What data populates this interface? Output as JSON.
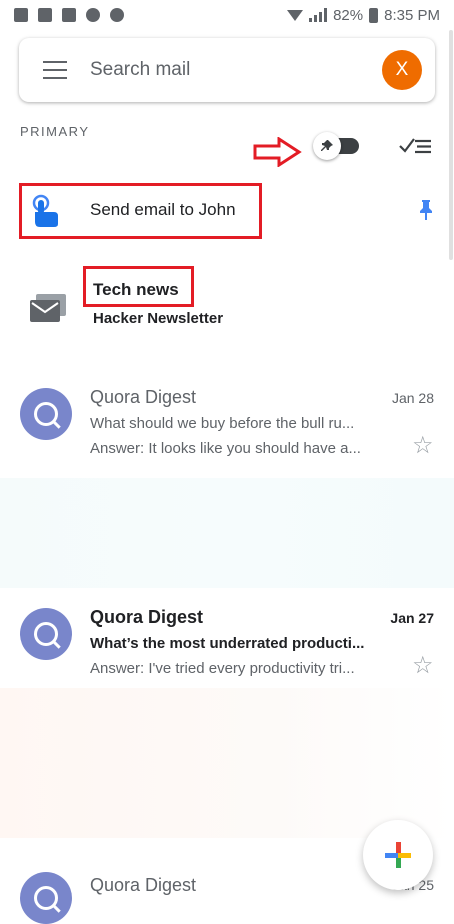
{
  "status_bar": {
    "battery": "82%",
    "time": "8:35 PM"
  },
  "search": {
    "placeholder": "Search mail",
    "avatar_letter": "X"
  },
  "section": {
    "label": "PRIMARY"
  },
  "pinned_item": {
    "label": "Send email to John"
  },
  "tech_news": {
    "title": "Tech news",
    "subtitle": "Hacker Newsletter"
  },
  "emails": [
    {
      "sender": "Quora Digest",
      "date": "Jan 28",
      "subject": "What should we buy before the bull ru...",
      "preview": "Answer: It looks like you should have a...",
      "avatar": "Q",
      "unread": false
    },
    {
      "sender": "Quora Digest",
      "date": "Jan 27",
      "subject": "What’s the most underrated producti...",
      "preview": "Answer: I've tried every productivity tri...",
      "avatar": "Q",
      "unread": true
    },
    {
      "sender": "Quora Digest",
      "date": "Jan 25",
      "avatar": "Q",
      "unread": false
    }
  ],
  "colors": {
    "accent_red": "#e31c25",
    "avatar_orange": "#ef6c00",
    "avatar_blue": "#7986cb",
    "pin_blue": "#4285f4"
  },
  "icons": [
    "menu-icon",
    "pin-icon",
    "checklist-icon",
    "tap-hand-icon",
    "envelope-icon",
    "star-icon",
    "compose-plus-icon"
  ]
}
